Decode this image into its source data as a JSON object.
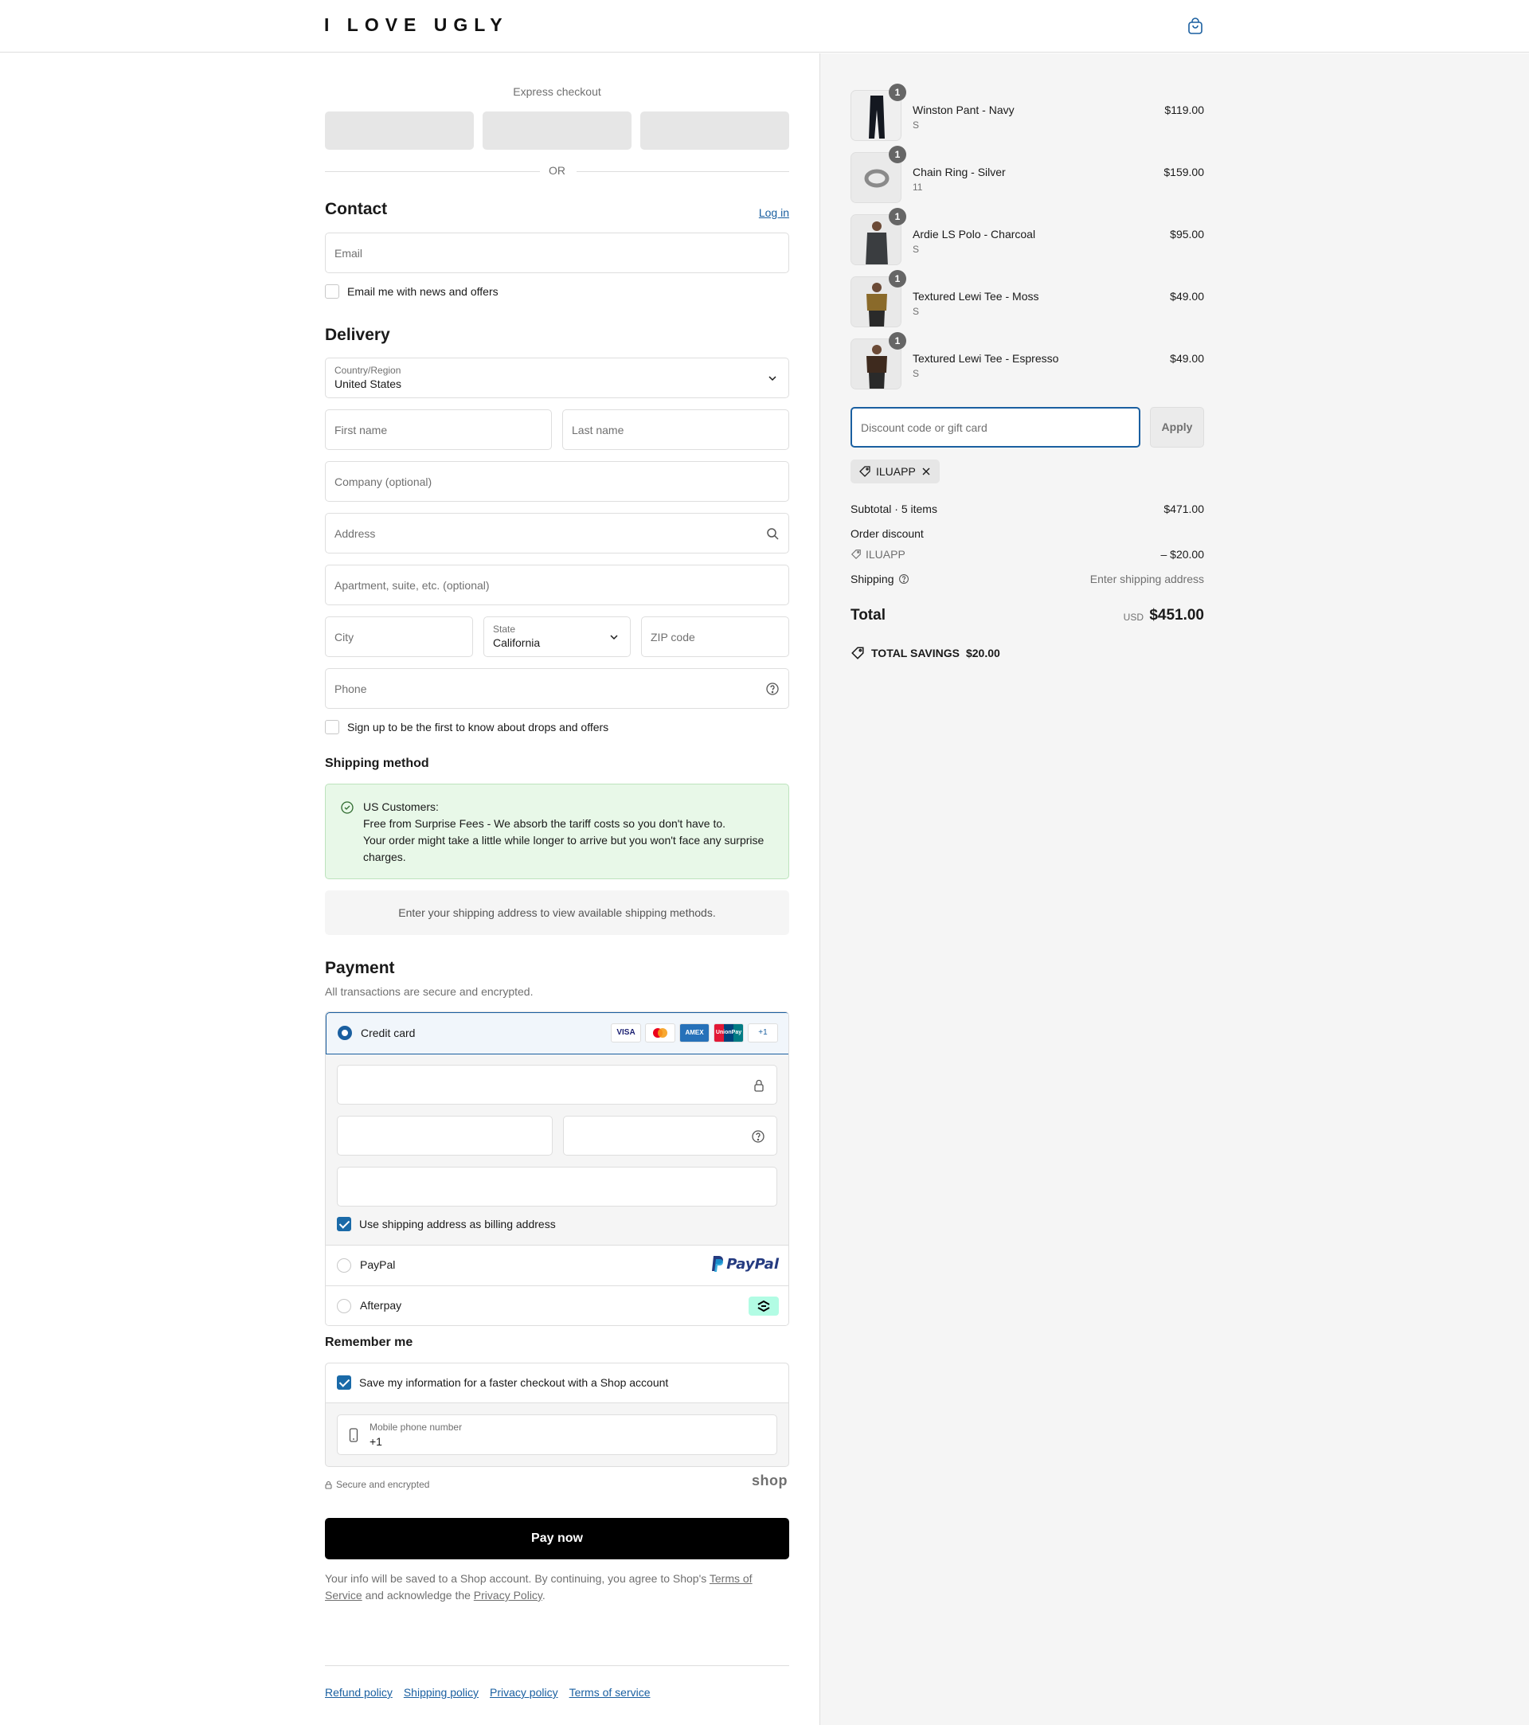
{
  "header": {
    "brand": "I LOVE UGLY"
  },
  "express": {
    "title": "Express checkout",
    "or": "OR"
  },
  "contact": {
    "title": "Contact",
    "login": "Log in",
    "email_placeholder": "Email",
    "news_optin": "Email me with news and offers"
  },
  "delivery": {
    "title": "Delivery",
    "country_label": "Country/Region",
    "country_value": "United States",
    "first_name": "First name",
    "last_name": "Last name",
    "company": "Company (optional)",
    "address": "Address",
    "apartment": "Apartment, suite, etc. (optional)",
    "city": "City",
    "state_label": "State",
    "state_value": "California",
    "zip": "ZIP code",
    "phone": "Phone",
    "drops_optin": "Sign up to be the first to know about drops and offers"
  },
  "shipping": {
    "title": "Shipping method",
    "notice_line1": "US Customers:",
    "notice_line2": "Free from Surprise Fees - We absorb the tariff costs so you don't have to.",
    "notice_line3": "Your order might take a little while longer to arrive but you won't face any surprise charges.",
    "info": "Enter your shipping address to view available shipping methods."
  },
  "payment": {
    "title": "Payment",
    "subtitle": "All transactions are secure and encrypted.",
    "credit_card": "Credit card",
    "cards": [
      "VISA",
      "MC",
      "AMEX",
      "UnionPay",
      "+1"
    ],
    "billing_same": "Use shipping address as billing address",
    "paypal": "PayPal",
    "paypal_logo": "PayPal",
    "afterpay": "Afterpay"
  },
  "remember": {
    "title": "Remember me",
    "save_info": "Save my information for a faster checkout with a Shop account",
    "phone_label": "Mobile phone number",
    "phone_value": "+1",
    "secure": "Secure and encrypted",
    "shop": "shop"
  },
  "pay_now": "Pay now",
  "legal": {
    "text1": "Your info will be saved to a Shop account. By continuing, you agree to Shop's ",
    "tos": "Terms of Service",
    "text2": " and acknowledge the ",
    "privacy": "Privacy Policy",
    "text3": "."
  },
  "footer": {
    "links": [
      "Refund policy",
      "Shipping policy",
      "Privacy policy",
      "Terms of service"
    ]
  },
  "cart": {
    "items": [
      {
        "name": "Winston Pant - Navy",
        "variant": "S",
        "price": "$119.00",
        "qty": "1"
      },
      {
        "name": "Chain Ring - Silver",
        "variant": "11",
        "price": "$159.00",
        "qty": "1"
      },
      {
        "name": "Ardie LS Polo - Charcoal",
        "variant": "S",
        "price": "$95.00",
        "qty": "1"
      },
      {
        "name": "Textured Lewi Tee - Moss",
        "variant": "S",
        "price": "$49.00",
        "qty": "1"
      },
      {
        "name": "Textured Lewi Tee - Espresso",
        "variant": "S",
        "price": "$49.00",
        "qty": "1"
      }
    ],
    "discount_placeholder": "Discount code or gift card",
    "apply": "Apply",
    "applied_code": "ILUAPP",
    "subtotal_label": "Subtotal · 5 items",
    "subtotal": "$471.00",
    "order_discount": "Order discount",
    "discount_code": "ILUAPP",
    "discount_amount": "– $20.00",
    "shipping_label": "Shipping",
    "shipping_value": "Enter shipping address",
    "total_label": "Total",
    "currency": "USD",
    "total": "$451.00",
    "savings_label": "TOTAL SAVINGS",
    "savings_amount": "$20.00"
  },
  "colors": {
    "accent": "#1a5fa0",
    "notice_bg": "#e8f8e8",
    "pay_button": "#000000"
  }
}
